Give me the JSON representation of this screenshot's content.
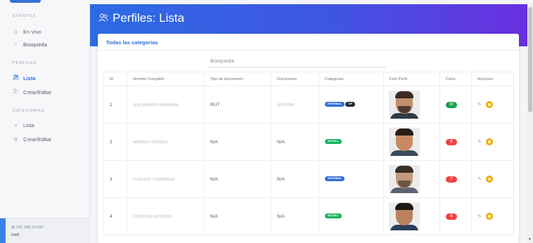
{
  "sidebar": {
    "eventos_title": "EVENTOS",
    "en_vivo": "En Vivo",
    "busqueda": "Búsqueda",
    "perfiles_title": "PERFILES",
    "lista": "Lista",
    "crear_editar": "Crear/Editar",
    "categorias_title": "CATEGORÍAS",
    "cat_lista": "Lista",
    "cat_crear_editar": "Crear/Editar",
    "footer_ip": "@ 192.168.10.159",
    "footer_user": "root"
  },
  "header": {
    "title": "Perfiles: Lista"
  },
  "card": {
    "categories_link": "Todas las categorias",
    "search_placeholder": "Búsqueda"
  },
  "table": {
    "columns": [
      "ID",
      "Nombre Completo",
      "Tipo de documento",
      "Documento",
      "Categorias",
      "Foto Perfil",
      "Fotos",
      "Acciones"
    ],
    "rows": [
      {
        "id": "1",
        "name": "ALEJANDRO HERRERA",
        "doc_type": "RUT",
        "doc": "18797082",
        "tags": [
          "INFORMAL",
          "VIP"
        ],
        "fotos": "17",
        "fotos_color": "#16a34a"
      },
      {
        "id": "2",
        "name": "ANDRES TORRES",
        "doc_type": "N/A",
        "doc": "N/A",
        "tags": [
          "INSTALL"
        ],
        "fotos": "6",
        "fotos_color": "#ef4444"
      },
      {
        "id": "3",
        "name": "CLAUDIO ITURRIAGA",
        "doc_type": "N/A",
        "doc": "N/A",
        "tags": [
          "INFORMAL"
        ],
        "fotos": "7",
        "fotos_color": "#ef4444"
      },
      {
        "id": "4",
        "name": "CRISTIAN ASTROZA",
        "doc_type": "N/A",
        "doc": "N/A",
        "tags": [
          "INSTALL"
        ],
        "fotos": "6",
        "fotos_color": "#ef4444"
      }
    ]
  },
  "colors": {
    "accent": "#2f6fd8",
    "header_start": "#2d6be4",
    "header_end": "#6a2fe0",
    "tag_info": "#2f6fd8",
    "tag_install": "#18b35e",
    "tag_vip": "#1f2937"
  }
}
